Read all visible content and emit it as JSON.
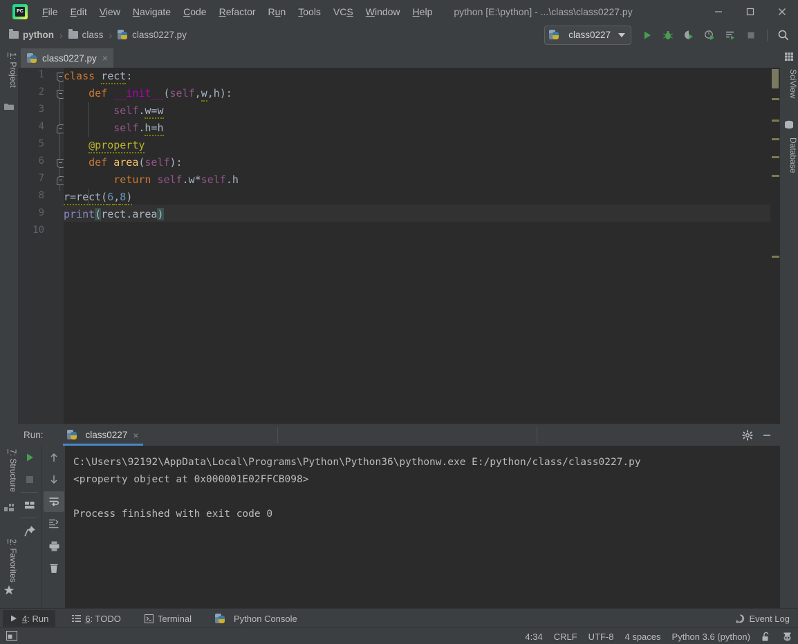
{
  "window": {
    "title": "python [E:\\python] - ...\\class\\class0227.py",
    "logo_text": "PC",
    "minimize": "minimize-icon",
    "maximize": "maximize-icon",
    "close": "close-icon"
  },
  "menu": [
    {
      "pre": "",
      "hot": "F",
      "post": "ile"
    },
    {
      "pre": "",
      "hot": "E",
      "post": "dit"
    },
    {
      "pre": "",
      "hot": "V",
      "post": "iew"
    },
    {
      "pre": "",
      "hot": "N",
      "post": "avigate"
    },
    {
      "pre": "",
      "hot": "C",
      "post": "ode"
    },
    {
      "pre": "",
      "hot": "R",
      "post": "efactor"
    },
    {
      "pre": "R",
      "hot": "u",
      "post": "n"
    },
    {
      "pre": "",
      "hot": "T",
      "post": "ools"
    },
    {
      "pre": "VC",
      "hot": "S",
      "post": ""
    },
    {
      "pre": "",
      "hot": "W",
      "post": "indow"
    },
    {
      "pre": "",
      "hot": "H",
      "post": "elp"
    }
  ],
  "navbar": {
    "breadcrumbs": [
      {
        "label": "python",
        "icon": "folder-icon",
        "bold": true
      },
      {
        "label": "class",
        "icon": "folder-icon",
        "bold": false
      },
      {
        "label": "class0227.py",
        "icon": "python-file-icon",
        "bold": false
      }
    ],
    "separator": "›",
    "run_config": "class0227",
    "toolbar_icons": [
      "run-icon",
      "debug-icon",
      "run-coverage-icon",
      "profile-icon",
      "run-with-console-icon",
      "stop-icon",
      "search-icon"
    ]
  },
  "left_strip": {
    "top": [
      {
        "pre": "",
        "hot": "1",
        "post": ": Project",
        "icon": "project-folder-icon"
      }
    ],
    "bottom": [
      {
        "pre": "",
        "hot": "7",
        "post": ": Structure",
        "icon": "structure-icon"
      },
      {
        "pre": "",
        "hot": "2",
        "post": ": Favorites",
        "icon": "star-icon"
      }
    ]
  },
  "right_strip": [
    {
      "label": "SciView",
      "icon": "sciview-grid-icon"
    },
    {
      "label": "Database",
      "icon": "database-icon"
    }
  ],
  "editor": {
    "tab": {
      "name": "class0227.py",
      "icon": "python-file-icon",
      "close": "×"
    },
    "line_numbers": [
      "1",
      "2",
      "3",
      "4",
      "5",
      "6",
      "7",
      "8",
      "9",
      "10"
    ],
    "caret_line": 9,
    "code": [
      {
        "n": 1,
        "tokens": [
          {
            "t": "class ",
            "c": "kw"
          },
          {
            "t": "rect",
            "c": "def squig"
          },
          {
            "t": ":",
            "c": "def"
          }
        ]
      },
      {
        "n": 2,
        "tokens": [
          {
            "t": "    ",
            "c": "def"
          },
          {
            "t": "def ",
            "c": "kw"
          },
          {
            "t": "__init__",
            "c": "mag"
          },
          {
            "t": "(",
            "c": "def"
          },
          {
            "t": "self",
            "c": "self"
          },
          {
            "t": ",",
            "c": "def"
          },
          {
            "t": "w",
            "c": "def squig"
          },
          {
            "t": ",",
            "c": "def"
          },
          {
            "t": "h",
            "c": "def"
          },
          {
            "t": "):",
            "c": "def"
          }
        ]
      },
      {
        "n": 3,
        "tokens": [
          {
            "t": "        ",
            "c": "def"
          },
          {
            "t": "self",
            "c": "self"
          },
          {
            "t": ".",
            "c": "def"
          },
          {
            "t": "w=w",
            "c": "def squig"
          }
        ]
      },
      {
        "n": 4,
        "tokens": [
          {
            "t": "        ",
            "c": "def"
          },
          {
            "t": "self",
            "c": "self"
          },
          {
            "t": ".",
            "c": "def"
          },
          {
            "t": "h=h",
            "c": "def squig"
          }
        ]
      },
      {
        "n": 5,
        "tokens": [
          {
            "t": "    ",
            "c": "def"
          },
          {
            "t": "@property",
            "c": "deco squig"
          }
        ]
      },
      {
        "n": 6,
        "tokens": [
          {
            "t": "    ",
            "c": "def"
          },
          {
            "t": "def ",
            "c": "kw"
          },
          {
            "t": "area",
            "c": "fn"
          },
          {
            "t": "(",
            "c": "def"
          },
          {
            "t": "self",
            "c": "self"
          },
          {
            "t": "):",
            "c": "def"
          }
        ]
      },
      {
        "n": 7,
        "tokens": [
          {
            "t": "        ",
            "c": "def"
          },
          {
            "t": "return ",
            "c": "kw"
          },
          {
            "t": "self",
            "c": "self"
          },
          {
            "t": ".w*",
            "c": "def"
          },
          {
            "t": "self",
            "c": "self"
          },
          {
            "t": ".h",
            "c": "def"
          }
        ]
      },
      {
        "n": 8,
        "tokens": [
          {
            "t": "r=rect(",
            "c": "def squig"
          },
          {
            "t": "6",
            "c": "num squig"
          },
          {
            "t": ",",
            "c": "def squig"
          },
          {
            "t": "8",
            "c": "num squig"
          },
          {
            "t": ")",
            "c": "def squig"
          }
        ]
      },
      {
        "n": 9,
        "tokens": [
          {
            "t": "print",
            "c": "bi"
          },
          {
            "t": "(",
            "c": "def brhl"
          },
          {
            "t": "rect.area",
            "c": "def"
          },
          {
            "t": ")",
            "c": "def brhl"
          }
        ]
      }
    ],
    "scrollbar_marks": 6
  },
  "run_panel": {
    "label": "Run:",
    "tab": {
      "name": "class0227",
      "icon": "python-icon",
      "close": "×"
    },
    "header_icons": [
      "settings-gear-icon",
      "hide-panel-icon"
    ],
    "toolbar_left": [
      "rerun-icon",
      "stop-icon",
      "layout-icon",
      "pin-icon"
    ],
    "toolbar_right": [
      "up-icon",
      "down-icon",
      "soft-wrap-icon",
      "scroll-to-end-icon",
      "print-icon",
      "clear-all-icon"
    ],
    "console": [
      "C:\\Users\\92192\\AppData\\Local\\Programs\\Python\\Python36\\pythonw.exe E:/python/class/class0227.py",
      "<property object at 0x000001E02FFCB098>",
      "",
      "Process finished with exit code 0"
    ]
  },
  "bottom_tabs": [
    {
      "pre": "",
      "hot": "4",
      "post": ": Run",
      "icon": "run-triangle-icon",
      "active": true
    },
    {
      "pre": "",
      "hot": "6",
      "post": ": TODO",
      "icon": "todo-list-icon",
      "active": false
    },
    {
      "pre": "",
      "hot": "",
      "post": "Terminal",
      "icon": "terminal-icon",
      "active": false
    },
    {
      "pre": "",
      "hot": "",
      "post": "Python Console",
      "icon": "python-icon",
      "active": false
    }
  ],
  "event_log": {
    "label": "Event Log",
    "icon": "event-log-icon"
  },
  "status_bar": {
    "caret_position": "4:34",
    "line_separator": "CRLF",
    "encoding": "UTF-8",
    "indent": "4 spaces",
    "interpreter": "Python 3.6 (python)",
    "lock_icon": "unlocked-icon",
    "inspector_icon": "inspector-hector-icon",
    "left_icon": "layout-toggle-icon"
  },
  "colors": {
    "chrome": "#3c3f41",
    "editor_bg": "#2b2b2b",
    "gutter_bg": "#313335",
    "accent_blue": "#4a88c7",
    "keyword": "#cc7832",
    "function": "#ffc66d",
    "decorator": "#bbb529",
    "number": "#6897bb",
    "builtin": "#8888c6",
    "self": "#94558d",
    "magic": "#b200b2",
    "text": "#a9b7c6"
  }
}
